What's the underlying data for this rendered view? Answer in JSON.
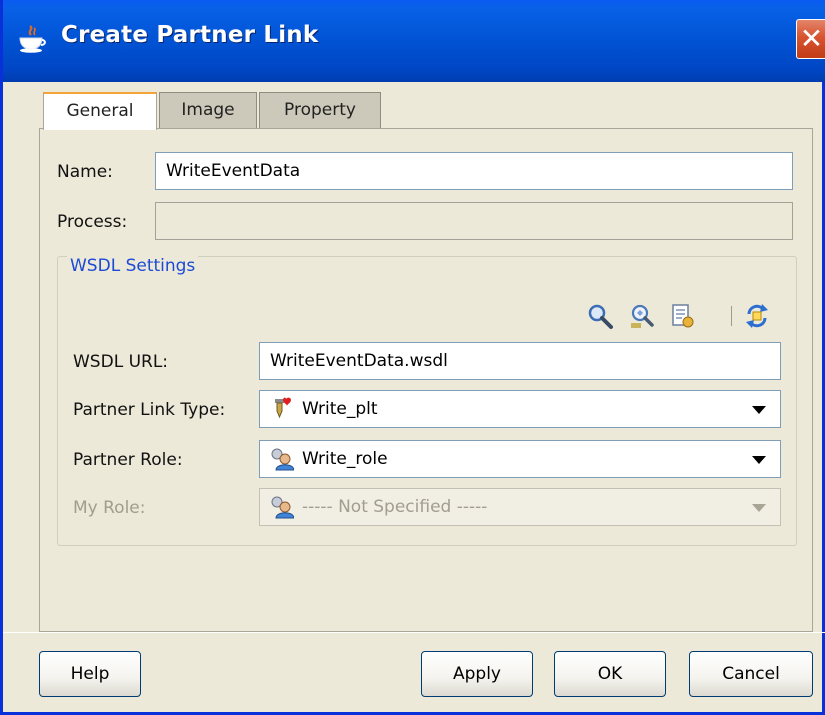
{
  "window": {
    "title": "Create Partner Link",
    "close_label": "✕",
    "colors": {
      "titlebar": "#0153d4",
      "close": "#d8532f",
      "legend": "#1c4ad6",
      "face": "#ece9d8"
    }
  },
  "tabs": [
    {
      "label": "General",
      "active": true
    },
    {
      "label": "Image",
      "active": false
    },
    {
      "label": "Property",
      "active": false
    }
  ],
  "form": {
    "name_label": "Name:",
    "name_value": "WriteEventData",
    "process_label": "Process:",
    "process_value": ""
  },
  "wsdl": {
    "legend": "WSDL Settings",
    "toolbar_icons": [
      "search-icon",
      "inspect-icon",
      "document-icon",
      "refresh-icon"
    ],
    "url_label": "WSDL URL:",
    "url_value": "WriteEventData.wsdl",
    "partner_link_type_label": "Partner Link Type:",
    "partner_link_type_value": "Write_plt",
    "partner_role_label": "Partner Role:",
    "partner_role_value": "Write_role",
    "my_role_label": "My Role:",
    "my_role_value": "----- Not Specified -----"
  },
  "buttons": {
    "help": "Help",
    "apply": "Apply",
    "ok": "OK",
    "cancel": "Cancel"
  }
}
